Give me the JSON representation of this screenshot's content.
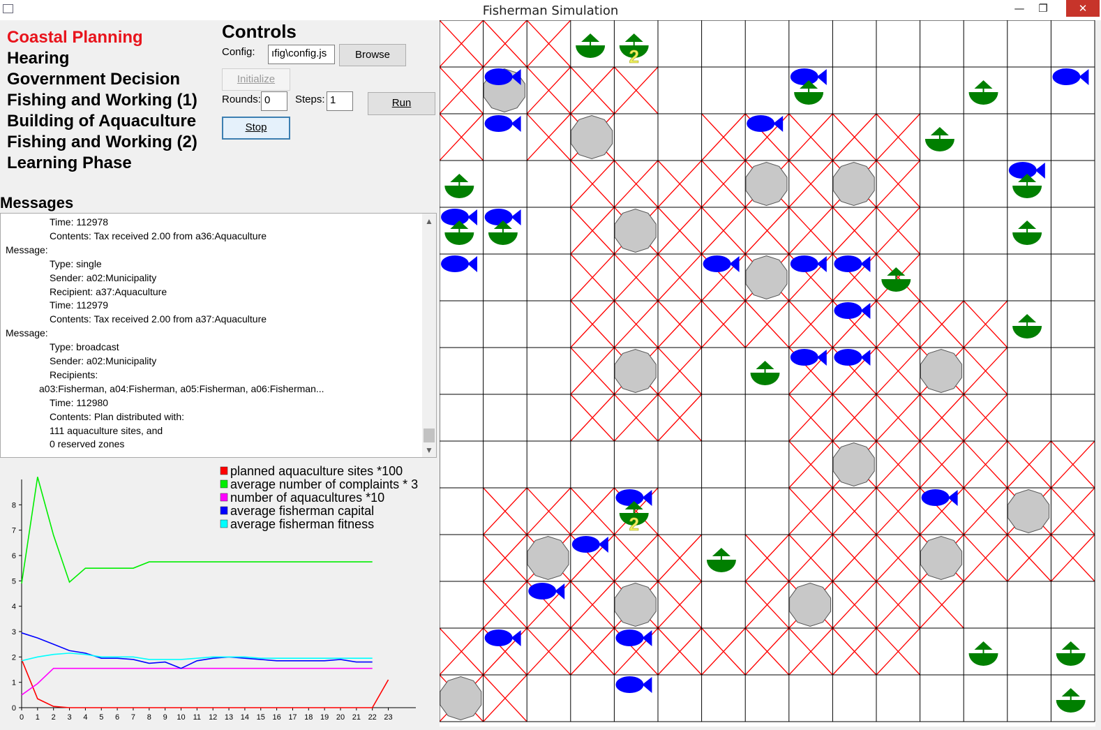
{
  "window": {
    "title": "Fisherman Simulation",
    "minimize": "—",
    "maximize": "❐",
    "close": "✕"
  },
  "phases": [
    {
      "label": "Coastal Planning",
      "active": true
    },
    {
      "label": "Hearing",
      "active": false
    },
    {
      "label": "Government Decision",
      "active": false
    },
    {
      "label": "Fishing and Working (1)",
      "active": false
    },
    {
      "label": "Building of Aquaculture",
      "active": false
    },
    {
      "label": "Fishing and Working (2)",
      "active": false
    },
    {
      "label": "Learning Phase",
      "active": false
    }
  ],
  "controls": {
    "title": "Controls",
    "config_label": "Config:",
    "config_value": "ıfig\\config.js",
    "browse_label": "Browse",
    "initialize_label": "Initialize",
    "rounds_label": "Rounds:",
    "rounds_value": "0",
    "steps_label": "Steps:",
    "steps_value": "1",
    "run_label": "Run",
    "stop_label": "Stop"
  },
  "messages": {
    "title": "Messages",
    "lines": [
      {
        "indent": 2,
        "text": "Time: 112978"
      },
      {
        "indent": 2,
        "text": "Contents: Tax received 2.00 from a36:Aquaculture"
      },
      {
        "indent": 0,
        "text": "Message:"
      },
      {
        "indent": 2,
        "text": "Type: single"
      },
      {
        "indent": 2,
        "text": "Sender: a02:Municipality"
      },
      {
        "indent": 2,
        "text": "Recipient: a37:Aquaculture"
      },
      {
        "indent": 2,
        "text": "Time: 112979"
      },
      {
        "indent": 2,
        "text": "Contents: Tax received 2.00 from a37:Aquaculture"
      },
      {
        "indent": 0,
        "text": "Message:"
      },
      {
        "indent": 2,
        "text": "Type: broadcast"
      },
      {
        "indent": 2,
        "text": "Sender: a02:Municipality"
      },
      {
        "indent": 2,
        "text": "Recipients:"
      },
      {
        "indent": 1,
        "text": "a03:Fisherman, a04:Fisherman, a05:Fisherman, a06:Fisherman..."
      },
      {
        "indent": 2,
        "text": "Time: 112980"
      },
      {
        "indent": 2,
        "text": "Contents: Plan distributed with:"
      },
      {
        "indent": 2,
        "text": "111 aquaculture sites, and"
      },
      {
        "indent": 2,
        "text": "0 reserved zones"
      }
    ]
  },
  "chart_data": {
    "type": "line",
    "x": [
      0,
      1,
      2,
      3,
      4,
      5,
      6,
      7,
      8,
      9,
      10,
      11,
      12,
      13,
      14,
      15,
      16,
      17,
      18,
      19,
      20,
      21,
      22,
      23
    ],
    "ylim": [
      0,
      9
    ],
    "xlim": [
      0,
      24
    ],
    "yticks": [
      0,
      1,
      2,
      3,
      4,
      5,
      6,
      7,
      8
    ],
    "grid": false,
    "legend_position": "top-right",
    "series": [
      {
        "name": "planned aquaculture sites *100",
        "color": "#ff0000",
        "values": [
          1.9,
          0.35,
          0.05,
          0,
          0,
          0,
          0,
          0,
          0,
          0,
          0,
          0,
          0,
          0,
          0,
          0,
          0,
          0,
          0,
          0,
          0,
          0,
          0,
          1.1
        ]
      },
      {
        "name": "average number of complaints * 3",
        "color": "#00ee00",
        "values": [
          4.9,
          9.1,
          6.8,
          4.95,
          5.5,
          5.5,
          5.5,
          5.5,
          5.75,
          5.75,
          5.75,
          5.75,
          5.75,
          5.75,
          5.75,
          5.75,
          5.75,
          5.75,
          5.75,
          5.75,
          5.75,
          5.75,
          5.75,
          null
        ]
      },
      {
        "name": "number of aquacultures *10",
        "color": "#ff00ff",
        "values": [
          0.5,
          0.95,
          1.55,
          1.55,
          1.55,
          1.55,
          1.55,
          1.55,
          1.55,
          1.55,
          1.55,
          1.55,
          1.55,
          1.55,
          1.55,
          1.55,
          1.55,
          1.55,
          1.55,
          1.55,
          1.55,
          1.55,
          1.55,
          null
        ]
      },
      {
        "name": "average fisherman capital",
        "color": "#0000ff",
        "values": [
          2.95,
          2.75,
          2.5,
          2.25,
          2.15,
          1.95,
          1.95,
          1.9,
          1.75,
          1.8,
          1.55,
          1.85,
          1.95,
          2.0,
          1.95,
          1.9,
          1.85,
          1.85,
          1.85,
          1.85,
          1.9,
          1.8,
          1.8,
          null
        ]
      },
      {
        "name": "average fisherman fitness",
        "color": "#00ffff",
        "values": [
          1.85,
          2.0,
          2.1,
          2.15,
          2.1,
          2.0,
          2.0,
          2.0,
          1.9,
          1.9,
          1.9,
          1.95,
          2.0,
          2.0,
          2.0,
          1.95,
          1.95,
          1.95,
          1.95,
          1.95,
          1.95,
          1.95,
          1.95,
          null
        ]
      }
    ]
  },
  "map": {
    "cols": 15,
    "rows": 15,
    "aquaculture_color": "#ff0000",
    "fish_color": "#0000ff",
    "boat_color": "#007f00",
    "rock_color": "#c8c8c8",
    "x_cells": [
      [
        0,
        0
      ],
      [
        1,
        0
      ],
      [
        2,
        0
      ],
      [
        0,
        1
      ],
      [
        2,
        1
      ],
      [
        3,
        1
      ],
      [
        4,
        1
      ],
      [
        0,
        2
      ],
      [
        2,
        2
      ],
      [
        3,
        2
      ],
      [
        6,
        2
      ],
      [
        7,
        2
      ],
      [
        8,
        2
      ],
      [
        9,
        2
      ],
      [
        10,
        2
      ],
      [
        3,
        3
      ],
      [
        4,
        3
      ],
      [
        5,
        3
      ],
      [
        6,
        3
      ],
      [
        7,
        3
      ],
      [
        8,
        3
      ],
      [
        9,
        3
      ],
      [
        10,
        3
      ],
      [
        3,
        4
      ],
      [
        4,
        4
      ],
      [
        5,
        4
      ],
      [
        6,
        4
      ],
      [
        7,
        4
      ],
      [
        8,
        4
      ],
      [
        9,
        4
      ],
      [
        10,
        4
      ],
      [
        3,
        5
      ],
      [
        4,
        5
      ],
      [
        5,
        5
      ],
      [
        6,
        5
      ],
      [
        7,
        5
      ],
      [
        8,
        5
      ],
      [
        9,
        5
      ],
      [
        10,
        5
      ],
      [
        3,
        6
      ],
      [
        4,
        6
      ],
      [
        5,
        6
      ],
      [
        6,
        6
      ],
      [
        7,
        6
      ],
      [
        8,
        6
      ],
      [
        9,
        6
      ],
      [
        10,
        6
      ],
      [
        11,
        6
      ],
      [
        12,
        6
      ],
      [
        3,
        7
      ],
      [
        4,
        7
      ],
      [
        5,
        7
      ],
      [
        8,
        7
      ],
      [
        9,
        7
      ],
      [
        10,
        7
      ],
      [
        11,
        7
      ],
      [
        12,
        7
      ],
      [
        3,
        8
      ],
      [
        4,
        8
      ],
      [
        5,
        8
      ],
      [
        8,
        8
      ],
      [
        9,
        8
      ],
      [
        10,
        8
      ],
      [
        11,
        8
      ],
      [
        12,
        8
      ],
      [
        8,
        9
      ],
      [
        9,
        9
      ],
      [
        10,
        9
      ],
      [
        11,
        9
      ],
      [
        12,
        9
      ],
      [
        13,
        9
      ],
      [
        14,
        9
      ],
      [
        1,
        10
      ],
      [
        2,
        10
      ],
      [
        3,
        10
      ],
      [
        4,
        10
      ],
      [
        8,
        10
      ],
      [
        9,
        10
      ],
      [
        10,
        10
      ],
      [
        11,
        10
      ],
      [
        12,
        10
      ],
      [
        13,
        10
      ],
      [
        14,
        10
      ],
      [
        1,
        11
      ],
      [
        2,
        11
      ],
      [
        3,
        11
      ],
      [
        4,
        11
      ],
      [
        5,
        11
      ],
      [
        7,
        11
      ],
      [
        8,
        11
      ],
      [
        9,
        11
      ],
      [
        10,
        11
      ],
      [
        11,
        11
      ],
      [
        12,
        11
      ],
      [
        13,
        11
      ],
      [
        14,
        11
      ],
      [
        1,
        12
      ],
      [
        2,
        12
      ],
      [
        3,
        12
      ],
      [
        4,
        12
      ],
      [
        5,
        12
      ],
      [
        7,
        12
      ],
      [
        8,
        12
      ],
      [
        9,
        12
      ],
      [
        10,
        12
      ],
      [
        11,
        12
      ],
      [
        0,
        13
      ],
      [
        1,
        13
      ],
      [
        2,
        13
      ],
      [
        3,
        13
      ],
      [
        4,
        13
      ],
      [
        5,
        13
      ],
      [
        6,
        13
      ],
      [
        7,
        13
      ],
      [
        8,
        13
      ],
      [
        9,
        13
      ],
      [
        10,
        13
      ],
      [
        0,
        14
      ],
      [
        1,
        14
      ]
    ],
    "rocks": [
      [
        1,
        1
      ],
      [
        3,
        2
      ],
      [
        7,
        3
      ],
      [
        9,
        3
      ],
      [
        4,
        4
      ],
      [
        7,
        5
      ],
      [
        4,
        7
      ],
      [
        11,
        7
      ],
      [
        9,
        9
      ],
      [
        13,
        10
      ],
      [
        2,
        11
      ],
      [
        11,
        11
      ],
      [
        4,
        12
      ],
      [
        8,
        12
      ],
      [
        0,
        14
      ]
    ],
    "fish": [
      [
        1,
        1
      ],
      [
        8,
        1
      ],
      [
        14,
        1
      ],
      [
        1,
        2
      ],
      [
        7,
        2
      ],
      [
        13,
        3
      ],
      [
        0,
        4
      ],
      [
        1,
        4
      ],
      [
        0,
        5
      ],
      [
        6,
        5
      ],
      [
        8,
        5
      ],
      [
        9,
        5
      ],
      [
        9,
        6
      ],
      [
        8,
        7
      ],
      [
        9,
        7
      ],
      [
        4,
        10
      ],
      [
        11,
        10
      ],
      [
        3,
        11
      ],
      [
        2,
        12
      ],
      [
        1,
        13
      ],
      [
        4,
        13
      ],
      [
        4,
        14
      ]
    ],
    "boats": [
      [
        3,
        0
      ],
      [
        4,
        0
      ],
      [
        8,
        1
      ],
      [
        12,
        1
      ],
      [
        11,
        2
      ],
      [
        0,
        3
      ],
      [
        13,
        3
      ],
      [
        0,
        4
      ],
      [
        1,
        4
      ],
      [
        13,
        4
      ],
      [
        10,
        5
      ],
      [
        13,
        6
      ],
      [
        7,
        7
      ],
      [
        4,
        10
      ],
      [
        6,
        11
      ],
      [
        12,
        13
      ],
      [
        14,
        13
      ],
      [
        14,
        14
      ]
    ],
    "labels": [
      {
        "cell": [
          4,
          0
        ],
        "text": "2"
      },
      {
        "cell": [
          4,
          10
        ],
        "text": "2"
      }
    ]
  }
}
